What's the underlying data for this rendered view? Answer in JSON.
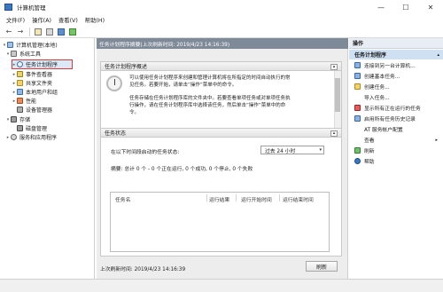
{
  "window": {
    "title": "计算机管理",
    "controls": [
      "minimize",
      "maximize",
      "close"
    ]
  },
  "menu": {
    "items": [
      "文件(F)",
      "操作(A)",
      "查看(V)",
      "帮助(H)"
    ]
  },
  "toolbar": {
    "buttons": [
      "back-arrow-icon",
      "forward-arrow-icon",
      "up-folder-icon",
      "show-hide-tree-icon",
      "help-icon",
      "properties-icon"
    ]
  },
  "tree": {
    "items": [
      {
        "label": "计算机管理(本地)",
        "level": 0,
        "expanded": true,
        "icon": "computer-icon"
      },
      {
        "label": "系统工具",
        "level": 1,
        "expanded": true,
        "icon": "tools-icon"
      },
      {
        "label": "任务计划程序",
        "level": 2,
        "expanded": false,
        "icon": "clock-icon",
        "selected": true
      },
      {
        "label": "事件查看器",
        "level": 2,
        "expanded": false,
        "icon": "event-viewer-icon"
      },
      {
        "label": "共享文件夹",
        "level": 2,
        "expanded": false,
        "icon": "shared-folder-icon"
      },
      {
        "label": "本地用户和组",
        "level": 2,
        "expanded": false,
        "icon": "users-icon"
      },
      {
        "label": "性能",
        "level": 2,
        "expanded": false,
        "icon": "performance-icon"
      },
      {
        "label": "设备管理器",
        "level": 2,
        "expanded": false,
        "icon": "device-manager-icon"
      },
      {
        "label": "存储",
        "level": 1,
        "expanded": true,
        "icon": "storage-icon"
      },
      {
        "label": "磁盘管理",
        "level": 2,
        "expanded": false,
        "icon": "disk-icon"
      },
      {
        "label": "服务和应用程序",
        "level": 1,
        "expanded": false,
        "icon": "services-icon"
      }
    ]
  },
  "center": {
    "header": "任务计划程序摘要(上次刷新时间: 2019/4/23 14:16:39)",
    "overview": {
      "title": "任务计划程序概述",
      "para1": [
        "可以使用任务计划程序来创建和管理计算机将在所指定的时间自动执行的常",
        "见任务。若要开始，请单击“操作”菜单中的命令。"
      ],
      "para2": [
        "任务存储在任务计划程序库的文件夹中。若要查看单项任务或对单项任务执",
        "行操作，请在任务计划程序库中选择该任务，然后单击“操作”菜单中的命",
        "令。"
      ]
    },
    "status": {
      "title": "任务状态",
      "period_label": "在以下时间段启动的任务状态:",
      "period_value": "过去 24 小时",
      "summary": "摘要: 总计 0 个 - 0 个正在运行, 0 个成功, 0 个停止, 0 个失败",
      "columns": [
        "任务名",
        "运行结果",
        "运行开始时间",
        "运行结束时间"
      ]
    },
    "footer": {
      "last_refresh": "上次刷新时间: 2019/4/23 14:16:39",
      "refresh_button": "刷新"
    }
  },
  "actions": {
    "header": "操作",
    "group": "任务计划程序",
    "items": [
      {
        "label": "连接到另一台计算机...",
        "icon": "connect-icon",
        "style": "blue"
      },
      {
        "label": "创建基本任务...",
        "icon": "create-basic-task-icon",
        "style": "blue"
      },
      {
        "label": "创建任务...",
        "icon": "create-task-icon",
        "style": "folder"
      },
      {
        "label": "导入任务...",
        "icon": "import-icon",
        "style": "none"
      },
      {
        "label": "显示所有正在运行的任务",
        "icon": "running-tasks-icon",
        "style": "red"
      },
      {
        "label": "启用所有任务历史记录",
        "icon": "history-icon",
        "style": "blue"
      },
      {
        "label": "AT 服务帐户配置",
        "icon": "at-config-icon",
        "style": "none"
      },
      {
        "label": "查看",
        "icon": "view-icon",
        "style": "none",
        "submenu": true
      },
      {
        "label": "刷新",
        "icon": "refresh-icon",
        "style": "green"
      },
      {
        "label": "帮助",
        "icon": "help-icon",
        "style": "help"
      }
    ]
  }
}
